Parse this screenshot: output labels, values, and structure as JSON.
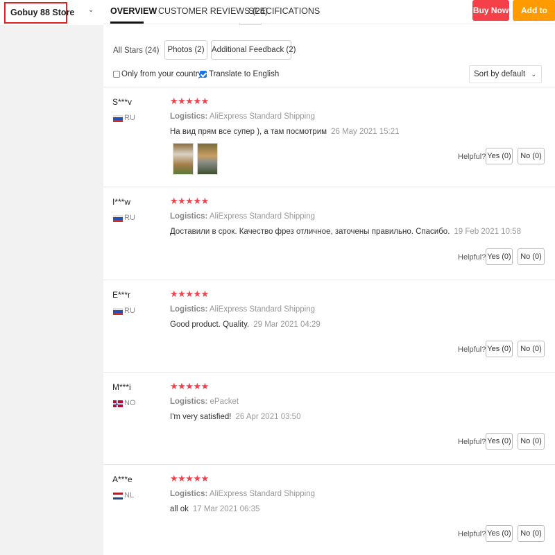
{
  "store": {
    "name": "Gobuy 88 Store"
  },
  "tabs": [
    {
      "label": "OVERVIEW",
      "active": true
    },
    {
      "label": "CUSTOMER REVIEWS (24)",
      "active": false
    },
    {
      "label": "SPECIFICATIONS",
      "active": false
    }
  ],
  "actions": {
    "buy_now": "Buy Now",
    "add_to_cart": "Add to Cart"
  },
  "filters": {
    "all_stars": "All Stars (24)",
    "photos": "Photos (2)",
    "additional_feedback": "Additional Feedback (2)"
  },
  "options": {
    "only_your_country": {
      "label": "Only from your country",
      "checked": false
    },
    "translate": {
      "label": "Translate to English",
      "checked": true
    },
    "sort": "Sort by default"
  },
  "helpful": {
    "label": "Helpful?",
    "yes": "Yes (0)",
    "no": "No (0)"
  },
  "logistics_label": "Logistics:",
  "stars_text": "★★★★★",
  "colors": {
    "accent_red": "#f5404a",
    "accent_orange": "#ff9a00"
  },
  "reviews": [
    {
      "user": "S***v",
      "country": "RU",
      "flag": "ru",
      "stars": 5,
      "logistics": "AliExpress Standard Shipping",
      "text": "На вид прям все супер ), а там посмотрим",
      "date": "26 May 2021 15:21",
      "photos": 2,
      "helpful_yes": "Yes (0)",
      "helpful_no": "No (0)"
    },
    {
      "user": "I***w",
      "country": "RU",
      "flag": "ru",
      "stars": 5,
      "logistics": "AliExpress Standard Shipping",
      "text": "Доставили в срок. Качество фрез отличное, заточены правильно. Спасибо.",
      "date": "19 Feb 2021 10:58",
      "photos": 0,
      "helpful_yes": "Yes (0)",
      "helpful_no": "No (0)"
    },
    {
      "user": "E***r",
      "country": "RU",
      "flag": "ru",
      "stars": 5,
      "logistics": "AliExpress Standard Shipping",
      "text": "Good product. Quality.",
      "date": "29 Mar 2021 04:29",
      "photos": 0,
      "helpful_yes": "Yes (0)",
      "helpful_no": "No (0)"
    },
    {
      "user": "M***i",
      "country": "NO",
      "flag": "no",
      "stars": 5,
      "logistics": "ePacket",
      "text": "I'm very satisfied!",
      "date": "26 Apr 2021 03:50",
      "photos": 0,
      "helpful_yes": "Yes (0)",
      "helpful_no": "No (0)"
    },
    {
      "user": "A***e",
      "country": "NL",
      "flag": "nl",
      "stars": 5,
      "logistics": "AliExpress Standard Shipping",
      "text": "all ok",
      "date": "17 Mar 2021 06:35",
      "photos": 0,
      "helpful_yes": "Yes (0)",
      "helpful_no": "No (0)"
    }
  ]
}
